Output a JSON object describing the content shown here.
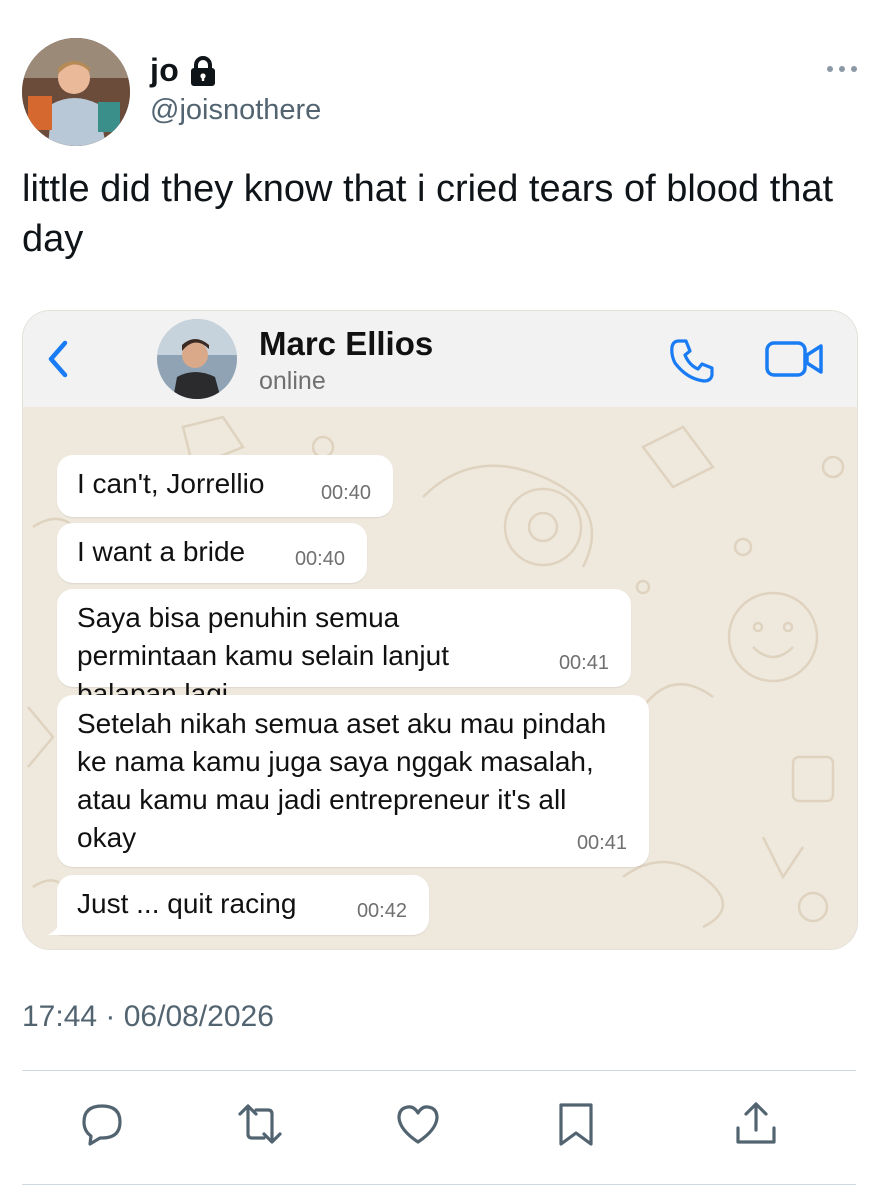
{
  "tweet": {
    "display_name": "jo",
    "handle": "@joisnothere",
    "text": "little did they know that i cried tears of blood that day",
    "timestamp": "17:44 · 06/08/2026",
    "protected_icon": "lock-icon",
    "more_icon": "more-dots-icon"
  },
  "chat": {
    "contact_name": "Marc Ellios",
    "status": "online",
    "accent_color": "#1a7cf5",
    "bubble_color": "#ffffff",
    "messages": [
      {
        "text": "I can't, Jorrellio",
        "time": "00:40"
      },
      {
        "text": "I want a bride",
        "time": "00:40"
      },
      {
        "text": "Saya bisa penuhin semua permintaan kamu selain lanjut balapan lagi",
        "time": "00:41"
      },
      {
        "text": "Setelah nikah semua aset aku mau pindah ke nama kamu juga saya nggak masalah, atau kamu mau jadi entrepreneur it's all okay",
        "time": "00:41"
      },
      {
        "text": "Just ... quit racing",
        "time": "00:42"
      }
    ]
  },
  "actions": [
    "reply-icon",
    "retweet-icon",
    "like-icon",
    "bookmark-icon",
    "share-icon"
  ]
}
